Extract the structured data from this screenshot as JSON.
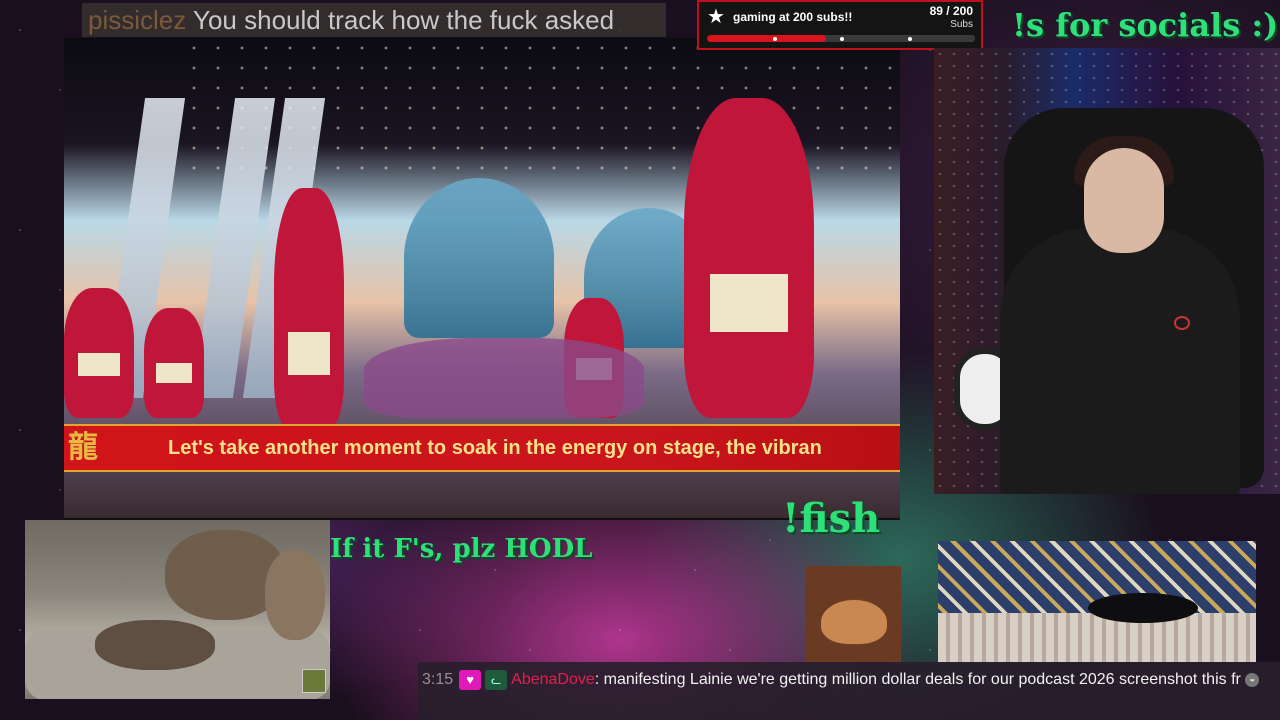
{
  "top_chat": {
    "username": "pissiclez",
    "message": " You should track how the fuck asked"
  },
  "sub_goal": {
    "title": "gaming at 200 subs!!",
    "count": "89 / 200",
    "unit": "Subs",
    "progress": 0.445
  },
  "socials_text": "!s for socials :)",
  "video": {
    "banner_text": "Let's take another moment to soak in the energy on stage, the vibran"
  },
  "fish_text": "!fish",
  "hodl_text": "If it F's, plz HODL",
  "bottom_chat": {
    "time": "3:15",
    "username": "AbenaDove",
    "message": "manifesting Lainie we're getting million dollar deals for our podcast 2026 screenshot this fr"
  },
  "icons": [
    "star-icon",
    "heart-badge-icon",
    "cat-badge-icon",
    "emote-icon"
  ],
  "colors": {
    "accent_green": "#2ee07a",
    "goal_red": "#d8141c",
    "chat_name_red": "#e0204a",
    "badge_pink": "#e01ab8"
  }
}
